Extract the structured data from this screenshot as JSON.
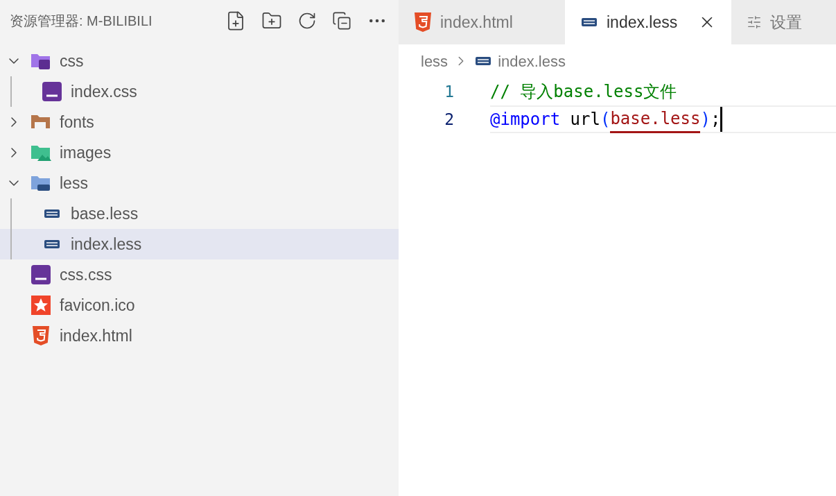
{
  "explorer": {
    "title": "资源管理器: M-BILIBILI"
  },
  "tree": [
    {
      "name": "css",
      "kind": "css",
      "expanded": true,
      "children": [
        {
          "name": "index.css",
          "kind": "css",
          "selected": false
        }
      ]
    },
    {
      "name": "fonts",
      "kind": "fonts",
      "expanded": false
    },
    {
      "name": "images",
      "kind": "images",
      "expanded": false
    },
    {
      "name": "less",
      "kind": "less",
      "expanded": true,
      "children": [
        {
          "name": "base.less",
          "kind": "less",
          "selected": false
        },
        {
          "name": "index.less",
          "kind": "less",
          "selected": true
        }
      ]
    },
    {
      "name": "css.css",
      "kind": "css",
      "selected": false
    },
    {
      "name": "favicon.ico",
      "kind": "favicon",
      "selected": false
    },
    {
      "name": "index.html",
      "kind": "html",
      "selected": false
    }
  ],
  "tabs": [
    {
      "label": "index.html",
      "kind": "html",
      "selected": false
    },
    {
      "label": "index.less",
      "kind": "less",
      "selected": true
    },
    {
      "label": "设置",
      "kind": "settings",
      "selected": false
    }
  ],
  "breadcrumb": {
    "folder": "less",
    "file": "index.less"
  },
  "lines": [
    {
      "number": "1",
      "current": false,
      "tokens": [
        {
          "text": "// 导入base.less文件",
          "kind": "comment"
        }
      ]
    },
    {
      "number": "2",
      "current": true,
      "tokens": [
        {
          "text": "@import",
          "kind": "keyword"
        },
        {
          "text": " url",
          "kind": "plain"
        },
        {
          "text": "(",
          "kind": "paren"
        },
        {
          "text": "base.less",
          "kind": "string",
          "error": true
        },
        {
          "text": ")",
          "kind": "paren"
        },
        {
          "text": ";",
          "kind": "plain"
        }
      ]
    }
  ]
}
